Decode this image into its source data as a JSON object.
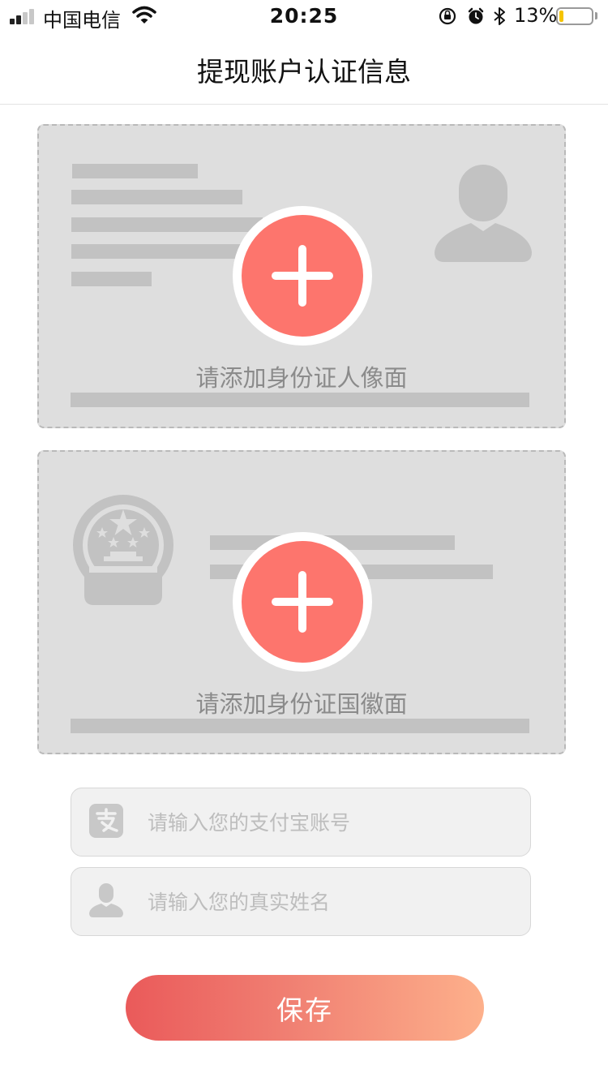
{
  "status_bar": {
    "carrier": "中国电信",
    "time": "20:25",
    "battery_percent": "13%",
    "battery_level": 0.13,
    "icons": [
      "signal-icon",
      "wifi-icon",
      "orientation-lock-icon",
      "alarm-icon",
      "bluetooth-icon",
      "battery-icon"
    ]
  },
  "nav": {
    "title": "提现账户认证信息"
  },
  "id_front": {
    "label": "请添加身份证人像面"
  },
  "id_back": {
    "label": "请添加身份证国徽面"
  },
  "alipay_input": {
    "placeholder": "请输入您的支付宝账号",
    "value": "",
    "icon": "alipay-icon"
  },
  "name_input": {
    "placeholder": "请输入您的真实姓名",
    "value": "",
    "icon": "user-icon"
  },
  "save": {
    "label": "保存"
  },
  "colors": {
    "accent": "#fd756d",
    "button_gradient_start": "#ea5a5a",
    "button_gradient_end": "#fdb08b",
    "card_bg": "#dedede",
    "placeholder": "#bdbdbd"
  }
}
